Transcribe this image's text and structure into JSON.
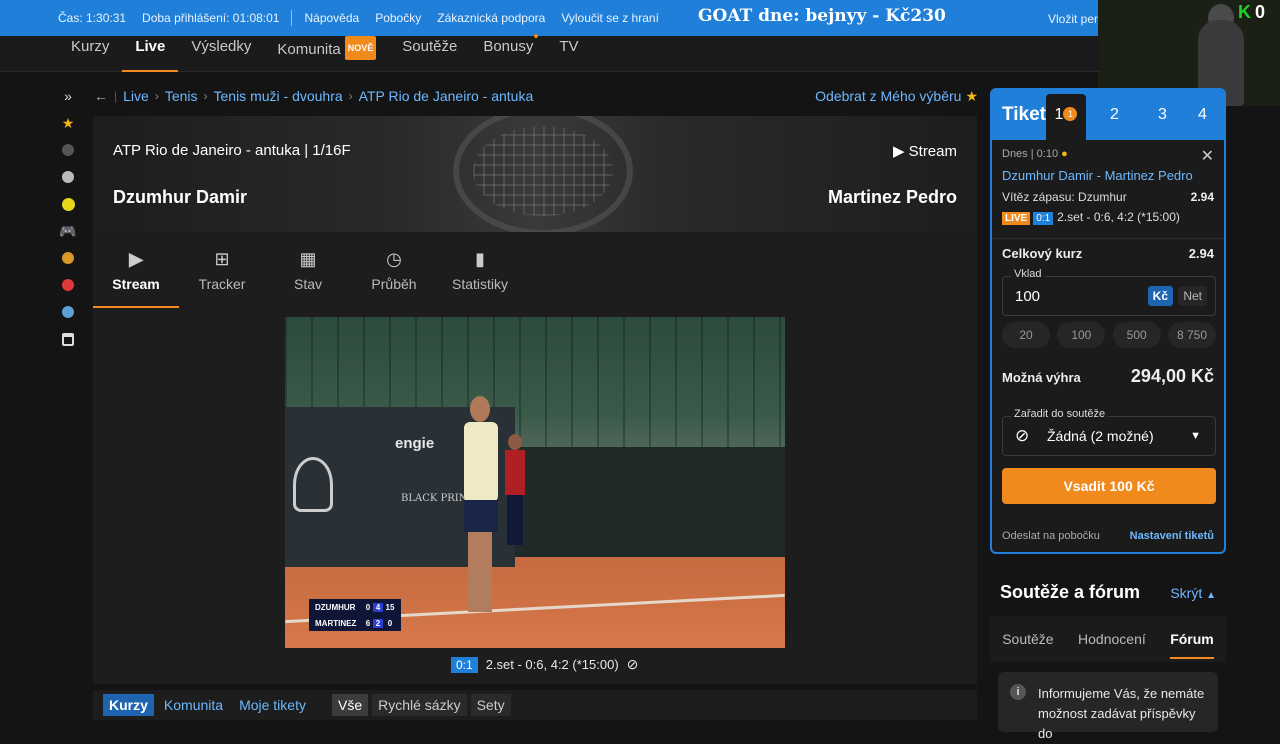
{
  "topbar": {
    "time": "Čas: 1:30:31",
    "login_duration": "Doba přihlášení: 01:08:01",
    "help": "Nápověda",
    "branches": "Pobočky",
    "support": "Zákaznická podpora",
    "self_exclude": "Vyloučit se z hraní",
    "goat": "GOAT dne: bejnyy - Kč230",
    "deposit_cut": "Vložit peníz"
  },
  "webcam": {
    "k_label": "K",
    "k_value": "0"
  },
  "nav": {
    "items": [
      "Kurzy",
      "Live",
      "Výsledky",
      "Komunita",
      "Soutěže",
      "Bonusy",
      "TV"
    ],
    "new_badge": "NOVĚ"
  },
  "breadcrumb": {
    "items": [
      "Live",
      "Tenis",
      "Tenis muži - dvouhra",
      "ATP Rio de Janeiro - antuka"
    ],
    "remove_fav": "Odebrat z Mého výběru"
  },
  "match": {
    "tournament": "ATP Rio de Janeiro - antuka  |  1/16F",
    "stream_label": "Stream",
    "player1": "Dzumhur Damir",
    "player2": "Martinez Pedro"
  },
  "tabs": [
    "Stream",
    "Tracker",
    "Stav",
    "Průběh",
    "Statistiky"
  ],
  "video": {
    "sponsor1": "engie",
    "sponsor2": "BLACK PRINCESS",
    "scoreboard": [
      {
        "name": "DZUMHUR",
        "g1": "0",
        "g2": "4",
        "pts": "15"
      },
      {
        "name": "MARTINEZ",
        "g1": "6",
        "g2": "2",
        "pts": "0"
      }
    ]
  },
  "status": {
    "score": "0:1",
    "text": "2.set - 0:6, 4:2 (*15:00)"
  },
  "bottom_tabs": {
    "primary": [
      "Kurzy",
      "Komunita",
      "Moje tikety"
    ],
    "secondary": [
      "Vše",
      "Rychlé sázky",
      "Sety"
    ]
  },
  "ticket": {
    "title": "Tiket",
    "tabs": [
      "1",
      "2",
      "3",
      "4"
    ],
    "tab_count": "1",
    "date": "Dnes | 0:10",
    "match": "Dzumhur Damir - Martinez Pedro",
    "market": "Vítěz zápasu: Dzumhur",
    "odds": "2.94",
    "live": "LIVE",
    "score": "0:1",
    "live_text": "2.set - 0:6, 4:2 (*15:00)",
    "total_label": "Celkový kurz",
    "total_odds": "2.94",
    "stake_label": "Vklad",
    "stake_value": "100",
    "currency": "Kč",
    "net": "Net",
    "quick": [
      "20",
      "100",
      "500",
      "8 750"
    ],
    "win_label": "Možná výhra",
    "win_value": "294,00 Kč",
    "contest_label": "Zařadit do soutěže",
    "contest_value": "Žádná (2 možné)",
    "bet_button": "Vsadit 100 Kč",
    "send_branch": "Odeslat na pobočku",
    "settings": "Nastavení tiketů"
  },
  "forum": {
    "title": "Soutěže a fórum",
    "hide": "Skrýt",
    "tabs": [
      "Soutěže",
      "Hodnocení",
      "Fórum"
    ],
    "info": "Informujeme Vás, že nemáte možnost zadávat příspěvky do"
  }
}
